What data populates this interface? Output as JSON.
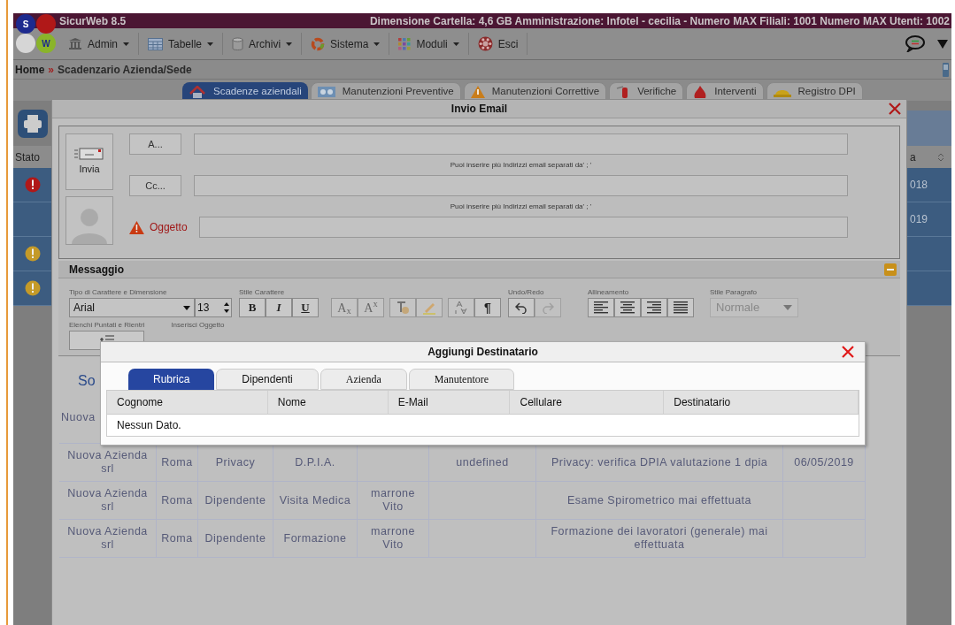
{
  "app": {
    "title": "SicurWeb 8.5",
    "info": "Dimensione Cartella: 4,6 GB Amministrazione: Infotel - cecilia - Numero MAX Filiali: 1001 Numero MAX Utenti: 1002"
  },
  "logo": {
    "letters": [
      "S",
      "W"
    ]
  },
  "menu": [
    {
      "label": "Admin",
      "kind": "bank",
      "dropdown": true
    },
    {
      "label": "Tabelle",
      "kind": "table",
      "dropdown": true
    },
    {
      "label": "Archivi",
      "kind": "cylinder",
      "dropdown": true
    },
    {
      "label": "Sistema",
      "kind": "ring",
      "dropdown": true
    },
    {
      "label": "Moduli",
      "kind": "grid",
      "dropdown": true
    },
    {
      "label": "Esci",
      "kind": "exit",
      "dropdown": false
    }
  ],
  "breadcrumb": {
    "home": "Home",
    "separator": "»",
    "current": "Scadenzario Azienda/Sede"
  },
  "tabs": [
    {
      "label": "Scadenze aziendali",
      "kind": "house",
      "selected": true
    },
    {
      "label": "Manutenzioni Preventive",
      "kind": "machine",
      "selected": false
    },
    {
      "label": "Manutenzioni Correttive",
      "kind": "warning",
      "selected": false
    },
    {
      "label": "Verifiche",
      "kind": "extinguisher",
      "selected": false
    },
    {
      "label": "Interventi",
      "kind": "fire",
      "selected": false
    },
    {
      "label": "Registro DPI",
      "kind": "helmet",
      "selected": false
    }
  ],
  "background": {
    "left_header": "Stato",
    "statuses": [
      {
        "kind": "error"
      },
      {
        "kind": "none"
      },
      {
        "kind": "warning"
      },
      {
        "kind": "warning"
      }
    ],
    "right_header": "a",
    "right_cells": [
      "018",
      "019"
    ]
  },
  "email_dialog": {
    "title": "Invio Email",
    "send": "Invia",
    "recipients": [
      {
        "button": "A...",
        "hint": "Puoi inserire più Indirizzi email separati da' ; '"
      },
      {
        "button": "Cc...",
        "hint": "Puoi inserire più Indirizzi email separati da' ; '"
      }
    ],
    "subject_label": "Oggetto",
    "message_title": "Messaggio",
    "labels": {
      "font": "Tipo di Carattere e Dimensione",
      "style": "Stile Carattere",
      "undo": "Undo/Redo",
      "align": "Allineamento",
      "paragraph": "Stile Paragrafo",
      "lists": "Elenchi Puntati e Rientri",
      "insert": "Inserisci Oggetto"
    },
    "font": "Arial",
    "size": "13",
    "style_buttons": [
      "B",
      "I",
      "U"
    ],
    "script_buttons": [
      "A$_{x}$",
      "A$^{x}$"
    ],
    "pilcrow": "¶",
    "redo_disabled": true,
    "paragraph_style": {
      "value": "Normale",
      "disabled": true
    },
    "section_fragment": "So",
    "rows": [
      [
        "Nuova",
        null,
        null,
        null,
        null,
        null,
        null,
        null
      ],
      [
        "Nuova Azienda srl",
        "Roma",
        "Privacy",
        "D.P.I.A.",
        null,
        "undefined",
        "Privacy: verifica DPIA valutazione 1 dpia",
        "06/05/2019"
      ],
      [
        "Nuova Azienda srl",
        "Roma",
        "Dipendente",
        "Visita Medica",
        "marrone Vito",
        null,
        "Esame Spirometrico mai effettuata",
        null
      ],
      [
        "Nuova Azienda srl",
        "Roma",
        "Dipendente",
        "Formazione",
        "marrone Vito",
        null,
        "Formazione dei lavoratori (generale) mai effettuata",
        null
      ]
    ]
  },
  "recipient_dialog": {
    "title": "Aggiungi Destinatario",
    "tabs": [
      {
        "label": "Rubrica",
        "serif": false,
        "selected": true
      },
      {
        "label": "Dipendenti",
        "serif": false,
        "selected": false
      },
      {
        "label": "Azienda",
        "serif": true,
        "selected": false
      },
      {
        "label": "Manutentore",
        "serif": true,
        "selected": false
      }
    ],
    "columns": [
      "Cognome",
      "Nome",
      "E-Mail",
      "Cellulare",
      "Destinatario"
    ],
    "empty": "Nessun Dato."
  }
}
